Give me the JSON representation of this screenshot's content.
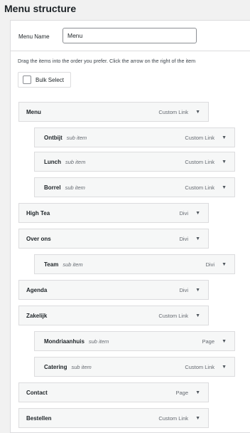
{
  "header": {
    "title": "Menu structure"
  },
  "menu_name": {
    "label": "Menu Name",
    "value": "Menu"
  },
  "instructions": "Drag the items into the order you prefer. Click the arrow on the right of the item",
  "bulk_select": {
    "label": "Bulk Select"
  },
  "items": [
    {
      "title": "Menu",
      "sub": "",
      "type": "Custom Link",
      "level": 0
    },
    {
      "title": "Ontbijt",
      "sub": "sub item",
      "type": "Custom Link",
      "level": 1
    },
    {
      "title": "Lunch",
      "sub": "sub item",
      "type": "Custom Link",
      "level": 1
    },
    {
      "title": "Borrel",
      "sub": "sub item",
      "type": "Custom Link",
      "level": 1
    },
    {
      "title": "High Tea",
      "sub": "",
      "type": "Divi",
      "level": 0
    },
    {
      "title": "Over ons",
      "sub": "",
      "type": "Divi",
      "level": 0
    },
    {
      "title": "Team",
      "sub": "sub item",
      "type": "Divi",
      "level": 1
    },
    {
      "title": "Agenda",
      "sub": "",
      "type": "Divi",
      "level": 0
    },
    {
      "title": "Zakelijk",
      "sub": "",
      "type": "Custom Link",
      "level": 0
    },
    {
      "title": "Mondriaanhuis",
      "sub": "sub item",
      "type": "Page",
      "level": 1
    },
    {
      "title": "Catering",
      "sub": "sub item",
      "type": "Custom Link",
      "level": 1
    },
    {
      "title": "Contact",
      "sub": "",
      "type": "Page",
      "level": 0
    },
    {
      "title": "Bestellen",
      "sub": "",
      "type": "Custom Link",
      "level": 0
    }
  ]
}
